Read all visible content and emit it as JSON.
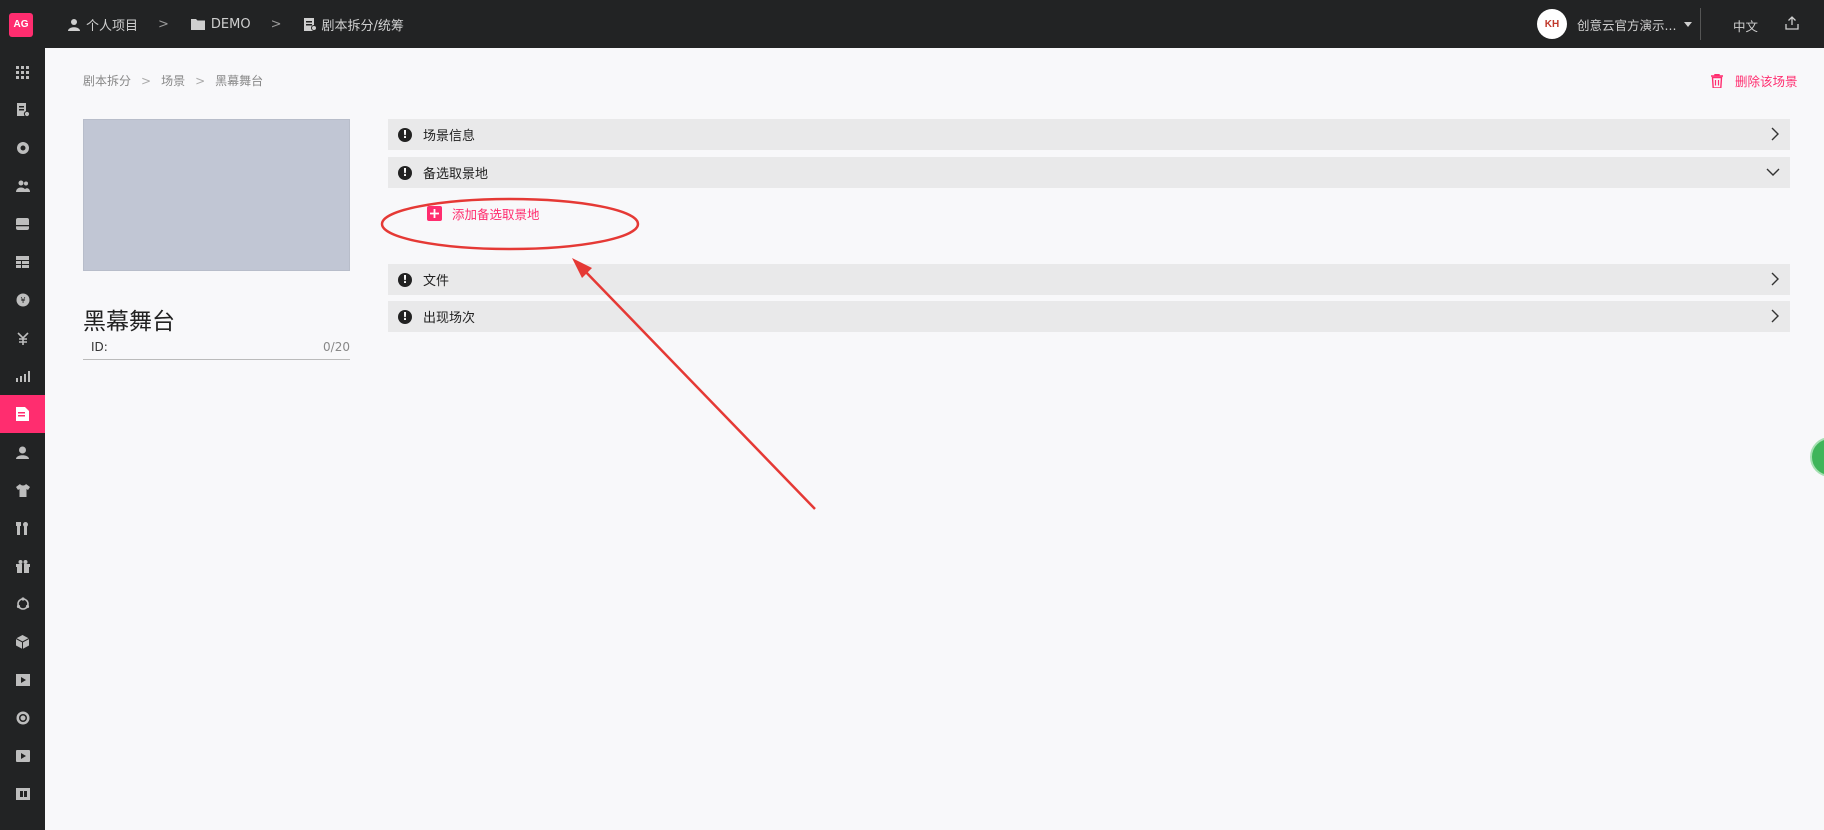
{
  "topbar": {
    "logo": "AG",
    "breadcrumbs": [
      "个人项目",
      "DEMO",
      "剧本拆分/统筹"
    ],
    "user_initials": "KH",
    "user_name": "创意云官方演示...",
    "language": "中文"
  },
  "sidebar": {
    "items": [
      {
        "icon": "grid-icon"
      },
      {
        "icon": "script-icon"
      },
      {
        "icon": "settings-icon"
      },
      {
        "icon": "team-icon"
      },
      {
        "icon": "database-icon"
      },
      {
        "icon": "table-icon"
      },
      {
        "icon": "coin-icon"
      },
      {
        "icon": "yen-icon"
      },
      {
        "icon": "bar-chart-icon"
      },
      {
        "icon": "document-icon",
        "active": true
      },
      {
        "icon": "person-icon"
      },
      {
        "icon": "shirt-icon"
      },
      {
        "icon": "tools-icon"
      },
      {
        "icon": "gift-icon"
      },
      {
        "icon": "cycle-icon"
      },
      {
        "icon": "box-icon"
      },
      {
        "icon": "media-icon"
      },
      {
        "icon": "target-icon"
      },
      {
        "icon": "video-icon"
      },
      {
        "icon": "film-strip-icon"
      }
    ]
  },
  "main": {
    "breadcrumb": [
      "剧本拆分",
      "场景",
      "黑幕舞台"
    ],
    "delete_label": "删除该场景",
    "scene_name": "黑幕舞台",
    "id_label": "ID:",
    "id_count": "0/20",
    "panels": [
      {
        "title": "场景信息",
        "expanded": false
      },
      {
        "title": "备选取景地",
        "expanded": true
      },
      {
        "title": "文件",
        "expanded": false
      },
      {
        "title": "出现场次",
        "expanded": false
      }
    ],
    "add_location_label": "添加备选取景地"
  },
  "colors": {
    "accent": "#ff2d6f",
    "topbar_bg": "#222324",
    "panel_bg": "#e9e9ea",
    "annotation": "#e53935"
  }
}
